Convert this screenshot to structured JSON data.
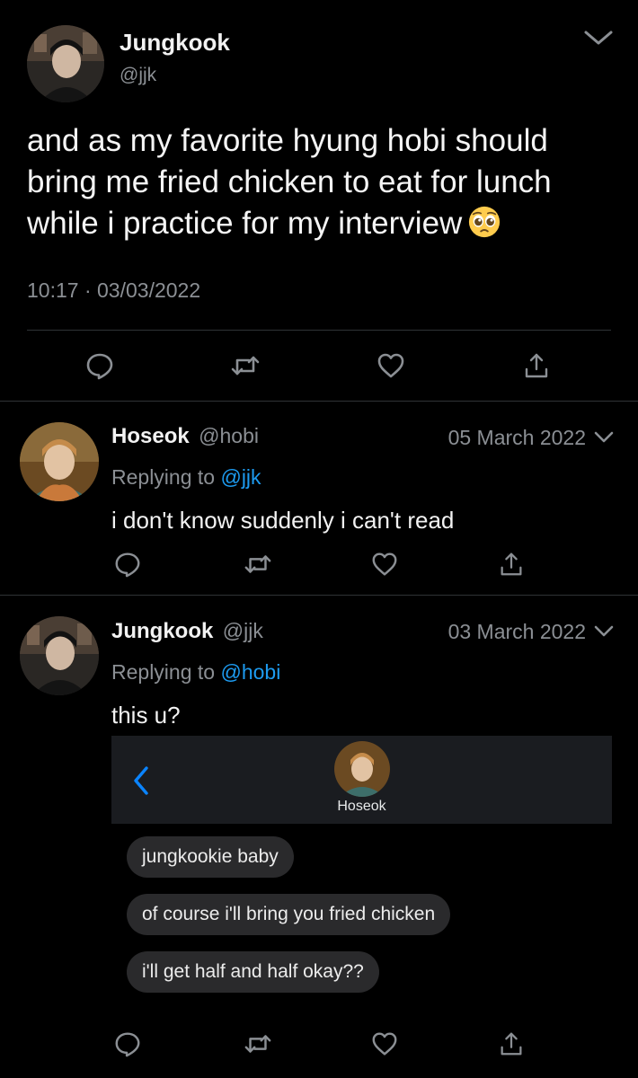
{
  "main_tweet": {
    "name": "Jungkook",
    "handle": "@jjk",
    "text": "and as my favorite hyung hobi should bring me fried chicken to eat for lunch while i practice for my interview",
    "emoji": "pleading-face-emoji",
    "time": "10:17",
    "separator": "·",
    "date": "03/03/2022"
  },
  "replies": [
    {
      "name": "Hoseok",
      "handle": "@hobi",
      "date": "05 March 2022",
      "replying_prefix": "Replying to",
      "replying_to": "@jjk",
      "text": "i don't know suddenly i can't read"
    },
    {
      "name": "Jungkook",
      "handle": "@jjk",
      "date": "03 March 2022",
      "replying_prefix": "Replying to",
      "replying_to": "@hobi",
      "text": "this u?",
      "attachment": {
        "contact_name": "Hoseok",
        "messages": [
          "jungkookie baby",
          "of course i'll bring you fried chicken",
          "i'll get half and half okay??"
        ]
      }
    }
  ],
  "actions": [
    "reply-icon",
    "retweet-icon",
    "like-icon",
    "share-icon"
  ],
  "colors": {
    "background": "#000000",
    "text": "#e7e9ea",
    "muted": "#8b8f94",
    "link": "#1d9bf0",
    "bubble": "#2a2a2c"
  }
}
